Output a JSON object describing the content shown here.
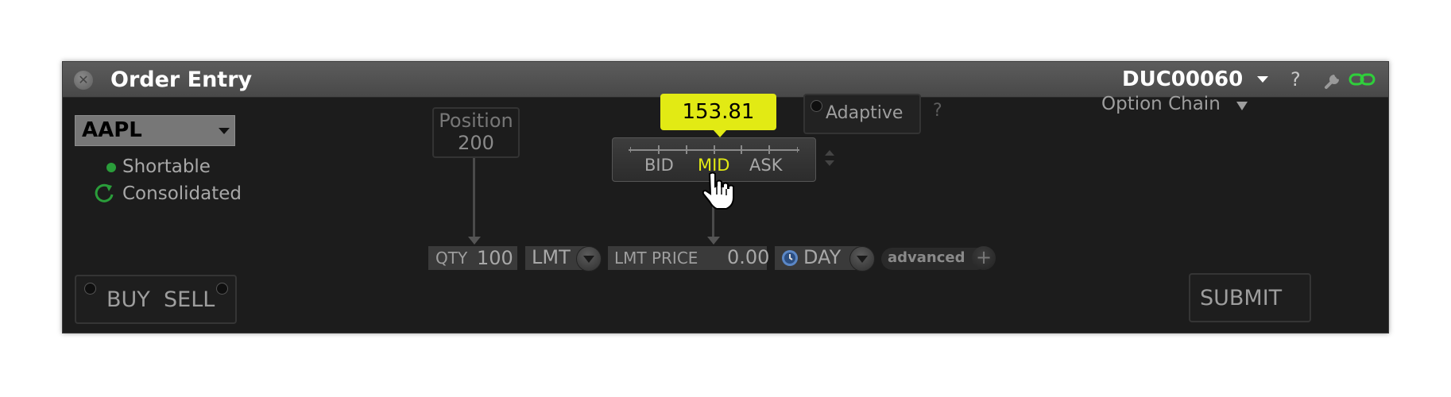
{
  "window": {
    "title": "Order Entry",
    "account": "DUC00060",
    "help": "?"
  },
  "symbol": {
    "ticker": "AAPL",
    "shortable": "Shortable",
    "consolidated": "Consolidated"
  },
  "side": {
    "buy": "BUY",
    "sell": "SELL"
  },
  "position": {
    "label": "Position",
    "value": "200"
  },
  "price": {
    "value": "153.81",
    "bid": "BID",
    "mid": "MID",
    "ask": "ASK"
  },
  "algo": {
    "adaptive": "Adaptive",
    "help": "?"
  },
  "option_chain": {
    "label": "Option Chain"
  },
  "order": {
    "qty_label": "QTY",
    "qty_value": "100",
    "type": "LMT",
    "lmt_price_label": "LMT PRICE",
    "lmt_price_value": "0.00",
    "tif": "DAY",
    "advanced": "advanced",
    "submit": "SUBMIT"
  },
  "colors": {
    "accent_yellow": "#e2ea14",
    "status_green": "#2a9d3a",
    "panel_bg": "#1c1c1c",
    "title_bg": "#505050"
  },
  "icons": [
    "close-icon",
    "chevron-down-icon",
    "help-icon",
    "wrench-icon",
    "link-icon",
    "refresh-icon",
    "hand-cursor-icon",
    "clock-icon",
    "plus-icon"
  ]
}
